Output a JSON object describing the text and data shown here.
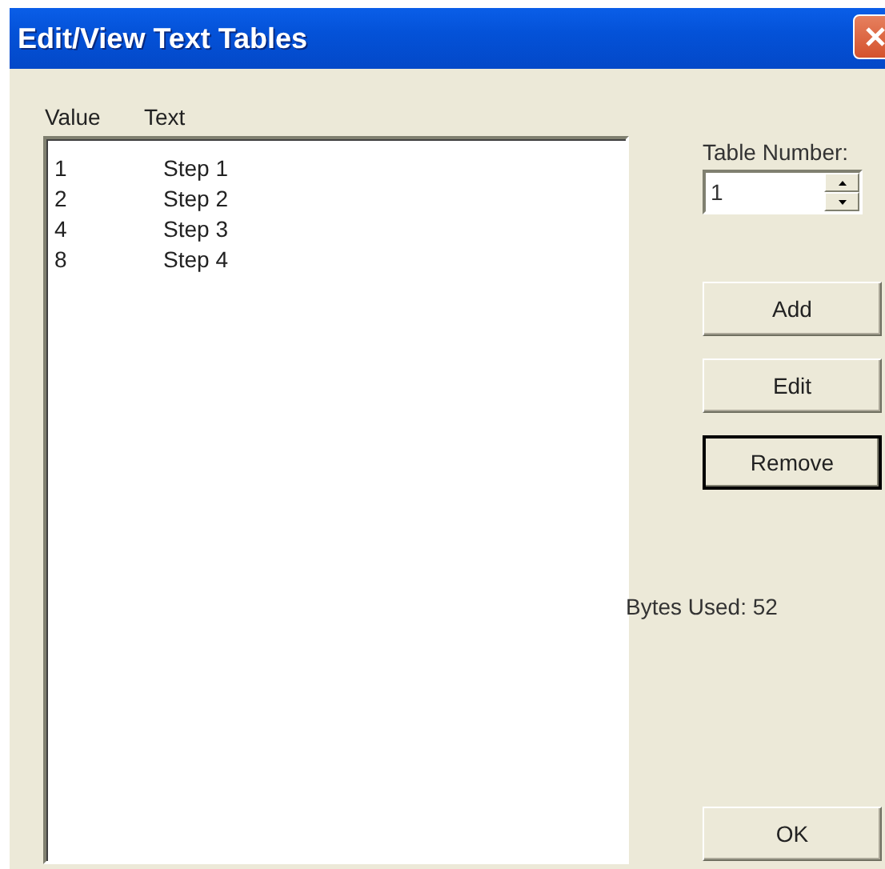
{
  "window": {
    "title": "Edit/View Text Tables"
  },
  "list": {
    "columns": [
      "Value",
      "Text"
    ],
    "rows": [
      {
        "value": "1",
        "text": "Step 1"
      },
      {
        "value": "2",
        "text": "Step 2"
      },
      {
        "value": "4",
        "text": "Step 3"
      },
      {
        "value": "8",
        "text": "Step 4"
      }
    ]
  },
  "table_number": {
    "label": "Table Number:",
    "value": "1"
  },
  "buttons": [
    {
      "label": "Add",
      "default": false
    },
    {
      "label": "Edit",
      "default": false
    },
    {
      "label": "Remove",
      "default": true
    }
  ],
  "bytes_used": "Bytes Used: 52",
  "ok_button": "OK"
}
